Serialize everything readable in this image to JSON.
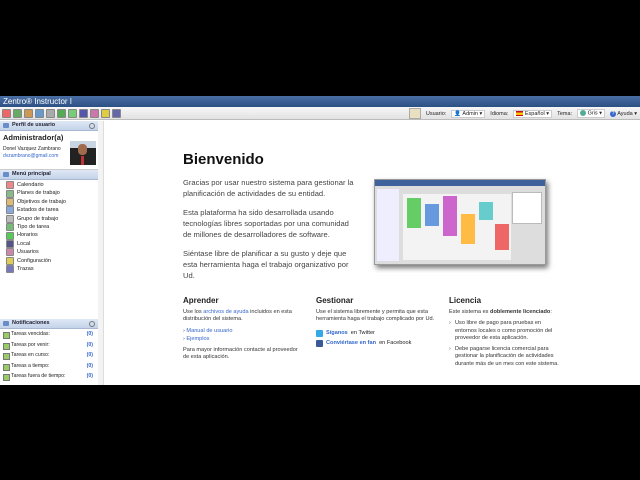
{
  "window": {
    "title": "Zentro® Instructor I"
  },
  "toolbar": {
    "user_label": "Usuario:",
    "user_value": "Admin",
    "language_label": "Idioma:",
    "language_value": "Español",
    "theme_label": "Tema:",
    "theme_value": "Gris",
    "help_label": "Ayuda"
  },
  "profile": {
    "header": "Perfil de usuario",
    "role": "Administrador(a)",
    "name": "Donel Vazquez Zambrano",
    "email": "dvzambrano@gmail.com"
  },
  "menu": {
    "header": "Menú principal",
    "items": [
      "Calendario",
      "Planes de trabajo",
      "Objetivos de trabajo",
      "Estados de tarea",
      "Grupo de trabajo",
      "Tipo de tarea",
      "Horarios",
      "Local",
      "Usuarios",
      "Configuración",
      "Trazas"
    ]
  },
  "notifications": {
    "header": "Notificaciones",
    "items": [
      {
        "label": "Tareas vencidas:",
        "count": "(0)"
      },
      {
        "label": "Tareas por venir:",
        "count": "(0)"
      },
      {
        "label": "Tareas en curso:",
        "count": "(0)"
      },
      {
        "label": "Tareas a tiempo:",
        "count": "(0)"
      },
      {
        "label": "Tareas fuera de tiempo:",
        "count": "(0)"
      }
    ]
  },
  "welcome": {
    "title": "Bienvenido",
    "p1": "Gracias por usar nuestro sistema para gestionar la planificación de actividades de su entidad.",
    "p2": "Esta plataforma ha sido desarrollada usando tecnologías libres soportadas por una comunidad de millones de desarrolladores de software.",
    "p3": "Siéntase libre de planificar a su gusto y deje que esta herramienta haga el trabajo organizativo por Ud."
  },
  "learn": {
    "title": "Aprender",
    "text_pre": "Use los ",
    "link": "archivos de ayuda",
    "text_post": " incluidos en esta distribución del sistema.",
    "manual": "Manual de usuario",
    "examples": "Ejemplos",
    "contact": "Para mayor información contacte al proveedor de esta aplicación."
  },
  "manage": {
    "title": "Gestionar",
    "text": "Use el sistema libremente y permita que esta herramienta haga el trabajo complicado por Ud.",
    "twitter_link": "Síganos",
    "twitter_text": " en Twitter",
    "facebook_link": "Conviértase en fan",
    "facebook_text": " en Facebook"
  },
  "license": {
    "title": "Licencia",
    "text_pre": "Este sistema es ",
    "text_bold": "doblemente licenciado",
    "text_post": ":",
    "item1": "Uso libre de pago para pruebas en entornos locales o como promoción del proveedor de esta aplicación.",
    "item2": "Debe pagarse licencia comercial para gestionar la planificación de actividades durante más de un mes con este sistema."
  }
}
